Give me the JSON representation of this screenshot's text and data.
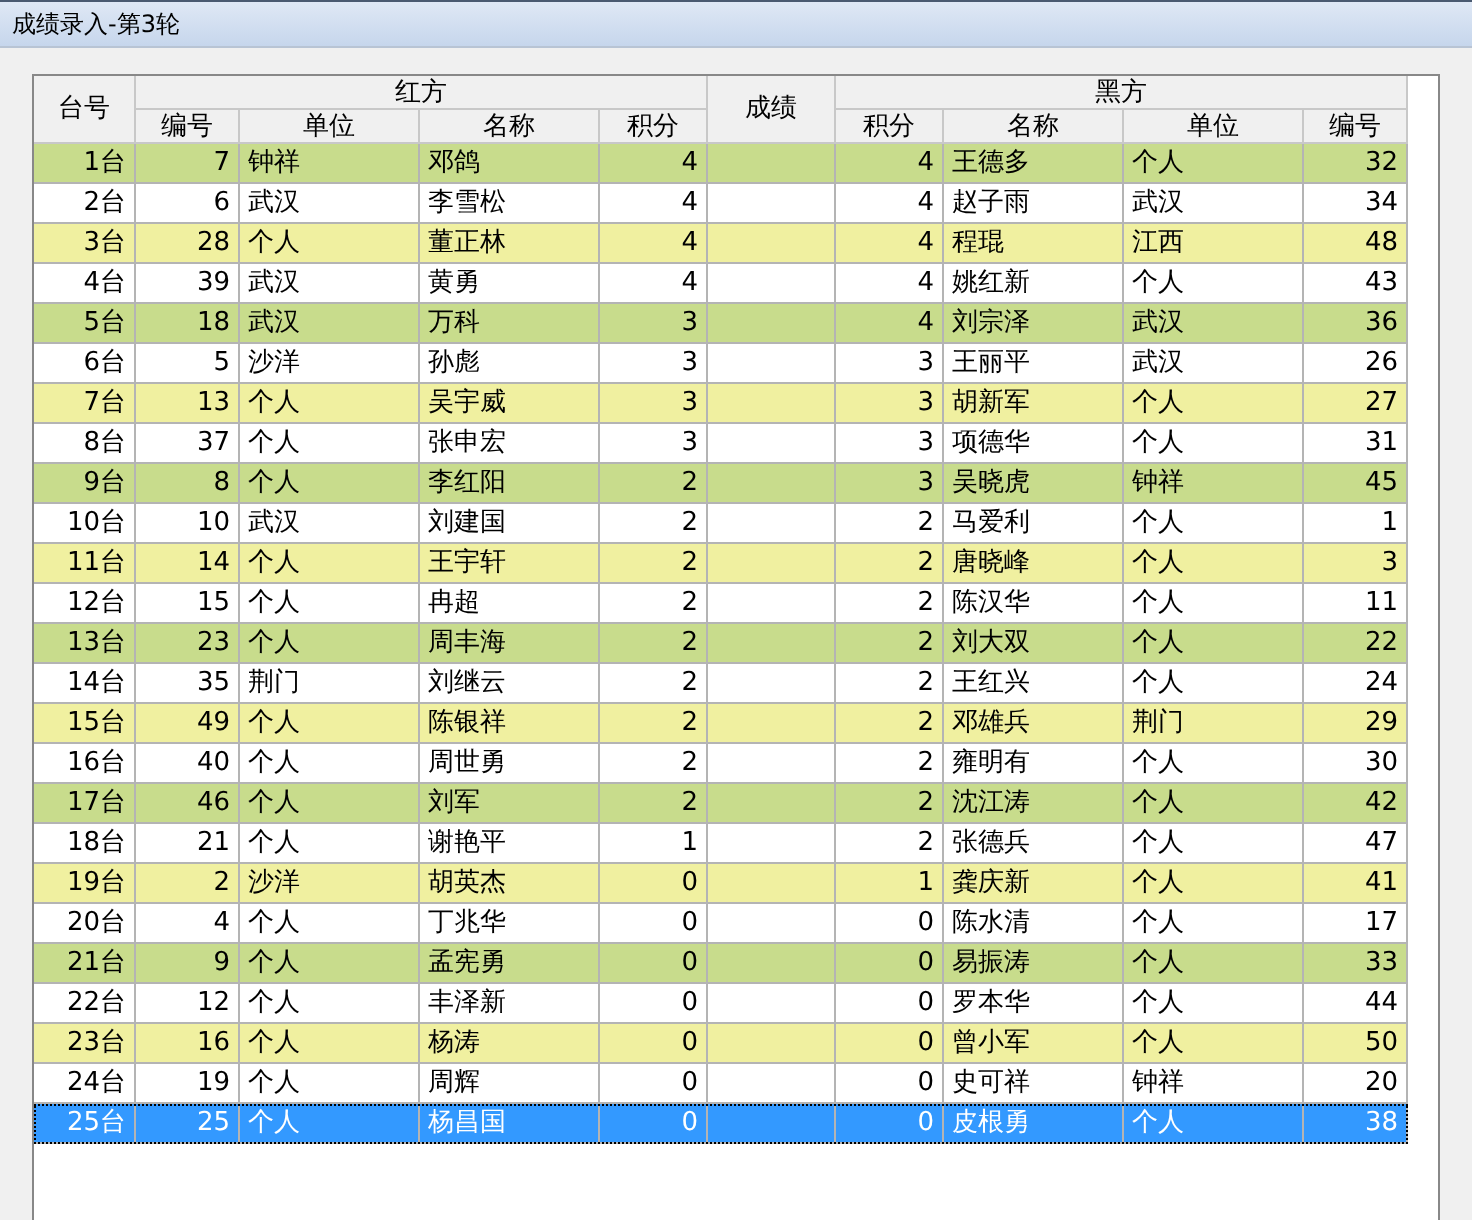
{
  "window": {
    "title": "成绩录入-第3轮"
  },
  "table": {
    "board_header": "台号",
    "result_header": "成绩",
    "red_header": "红方",
    "black_header": "黑方",
    "red_columns": [
      "编号",
      "单位",
      "名称",
      "积分"
    ],
    "black_columns": [
      "积分",
      "名称",
      "单位",
      "编号"
    ],
    "rows": [
      {
        "board": "1台",
        "red": [
          "7",
          "钟祥",
          "邓鸽",
          "4"
        ],
        "black": [
          "4",
          "王德多",
          "个人",
          "32"
        ],
        "color": "#c8dc8c",
        "selected": false
      },
      {
        "board": "2台",
        "red": [
          "6",
          "武汉",
          "李雪松",
          "4"
        ],
        "black": [
          "4",
          "赵子雨",
          "武汉",
          "34"
        ],
        "color": "#ffffff",
        "selected": false
      },
      {
        "board": "3台",
        "red": [
          "28",
          "个人",
          "董正林",
          "4"
        ],
        "black": [
          "4",
          "程琨",
          "江西",
          "48"
        ],
        "color": "#f0f0a0",
        "selected": false
      },
      {
        "board": "4台",
        "red": [
          "39",
          "武汉",
          "黄勇",
          "4"
        ],
        "black": [
          "4",
          "姚红新",
          "个人",
          "43"
        ],
        "color": "#ffffff",
        "selected": false
      },
      {
        "board": "5台",
        "red": [
          "18",
          "武汉",
          "万科",
          "3"
        ],
        "black": [
          "4",
          "刘宗泽",
          "武汉",
          "36"
        ],
        "color": "#c8dc8c",
        "selected": false
      },
      {
        "board": "6台",
        "red": [
          "5",
          "沙洋",
          "孙彪",
          "3"
        ],
        "black": [
          "3",
          "王丽平",
          "武汉",
          "26"
        ],
        "color": "#ffffff",
        "selected": false
      },
      {
        "board": "7台",
        "red": [
          "13",
          "个人",
          "吴宇威",
          "3"
        ],
        "black": [
          "3",
          "胡新军",
          "个人",
          "27"
        ],
        "color": "#f0f0a0",
        "selected": false
      },
      {
        "board": "8台",
        "red": [
          "37",
          "个人",
          "张申宏",
          "3"
        ],
        "black": [
          "3",
          "项德华",
          "个人",
          "31"
        ],
        "color": "#ffffff",
        "selected": false
      },
      {
        "board": "9台",
        "red": [
          "8",
          "个人",
          "李红阳",
          "2"
        ],
        "black": [
          "3",
          "吴晓虎",
          "钟祥",
          "45"
        ],
        "color": "#c8dc8c",
        "selected": false
      },
      {
        "board": "10台",
        "red": [
          "10",
          "武汉",
          "刘建国",
          "2"
        ],
        "black": [
          "2",
          "马爱利",
          "个人",
          "1"
        ],
        "color": "#ffffff",
        "selected": false
      },
      {
        "board": "11台",
        "red": [
          "14",
          "个人",
          "王宇轩",
          "2"
        ],
        "black": [
          "2",
          "唐晓峰",
          "个人",
          "3"
        ],
        "color": "#f0f0a0",
        "selected": false
      },
      {
        "board": "12台",
        "red": [
          "15",
          "个人",
          "冉超",
          "2"
        ],
        "black": [
          "2",
          "陈汉华",
          "个人",
          "11"
        ],
        "color": "#ffffff",
        "selected": false
      },
      {
        "board": "13台",
        "red": [
          "23",
          "个人",
          "周丰海",
          "2"
        ],
        "black": [
          "2",
          "刘大双",
          "个人",
          "22"
        ],
        "color": "#c8dc8c",
        "selected": false
      },
      {
        "board": "14台",
        "red": [
          "35",
          "荆门",
          "刘继云",
          "2"
        ],
        "black": [
          "2",
          "王红兴",
          "个人",
          "24"
        ],
        "color": "#ffffff",
        "selected": false
      },
      {
        "board": "15台",
        "red": [
          "49",
          "个人",
          "陈银祥",
          "2"
        ],
        "black": [
          "2",
          "邓雄兵",
          "荆门",
          "29"
        ],
        "color": "#f0f0a0",
        "selected": false
      },
      {
        "board": "16台",
        "red": [
          "40",
          "个人",
          "周世勇",
          "2"
        ],
        "black": [
          "2",
          "雍明有",
          "个人",
          "30"
        ],
        "color": "#ffffff",
        "selected": false
      },
      {
        "board": "17台",
        "red": [
          "46",
          "个人",
          "刘军",
          "2"
        ],
        "black": [
          "2",
          "沈江涛",
          "个人",
          "42"
        ],
        "color": "#c8dc8c",
        "selected": false
      },
      {
        "board": "18台",
        "red": [
          "21",
          "个人",
          "谢艳平",
          "1"
        ],
        "black": [
          "2",
          "张德兵",
          "个人",
          "47"
        ],
        "color": "#ffffff",
        "selected": false
      },
      {
        "board": "19台",
        "red": [
          "2",
          "沙洋",
          "胡英杰",
          "0"
        ],
        "black": [
          "1",
          "龚庆新",
          "个人",
          "41"
        ],
        "color": "#f0f0a0",
        "selected": false
      },
      {
        "board": "20台",
        "red": [
          "4",
          "个人",
          "丁兆华",
          "0"
        ],
        "black": [
          "0",
          "陈水清",
          "个人",
          "17"
        ],
        "color": "#ffffff",
        "selected": false
      },
      {
        "board": "21台",
        "red": [
          "9",
          "个人",
          "孟宪勇",
          "0"
        ],
        "black": [
          "0",
          "易振涛",
          "个人",
          "33"
        ],
        "color": "#c8dc8c",
        "selected": false
      },
      {
        "board": "22台",
        "red": [
          "12",
          "个人",
          "丰泽新",
          "0"
        ],
        "black": [
          "0",
          "罗本华",
          "个人",
          "44"
        ],
        "color": "#ffffff",
        "selected": false
      },
      {
        "board": "23台",
        "red": [
          "16",
          "个人",
          "杨涛",
          "0"
        ],
        "black": [
          "0",
          "曾小军",
          "个人",
          "50"
        ],
        "color": "#f0f0a0",
        "selected": false
      },
      {
        "board": "24台",
        "red": [
          "19",
          "个人",
          "周辉",
          "0"
        ],
        "black": [
          "0",
          "史可祥",
          "钟祥",
          "20"
        ],
        "color": "#ffffff",
        "selected": false
      },
      {
        "board": "25台",
        "red": [
          "25",
          "个人",
          "杨昌国",
          "0"
        ],
        "black": [
          "0",
          "皮根勇",
          "个人",
          "38"
        ],
        "selected": true
      }
    ]
  }
}
